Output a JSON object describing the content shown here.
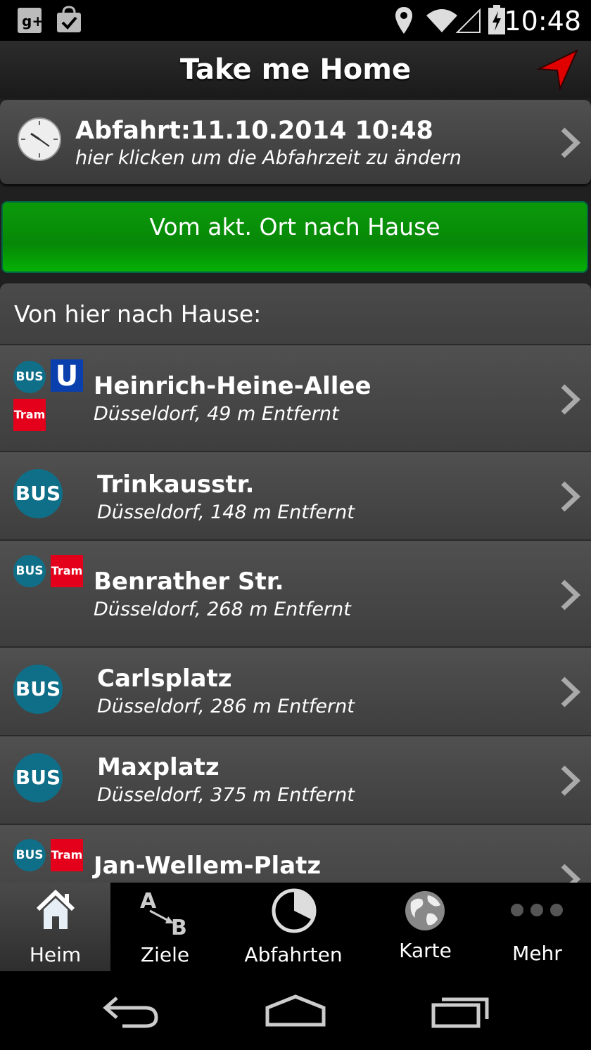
{
  "status_bar": {
    "time": "10:48"
  },
  "app_bar": {
    "title": "Take me Home"
  },
  "departure": {
    "title": "Abfahrt:11.10.2014 10:48",
    "subtitle": "hier klicken um die Abfahrzeit zu ändern"
  },
  "home_button": {
    "label": "Vom akt. Ort nach Hause"
  },
  "list": {
    "header": "Von hier nach Hause:",
    "badges": {
      "bus": "BUS",
      "tram": "Tram",
      "ubahn": "U"
    },
    "stops": [
      {
        "name": "Heinrich-Heine-Allee",
        "detail": "Düsseldorf, 49 m Entfernt"
      },
      {
        "name": "Trinkausstr.",
        "detail": "Düsseldorf, 148 m Entfernt"
      },
      {
        "name": "Benrather Str.",
        "detail": "Düsseldorf, 268 m Entfernt"
      },
      {
        "name": "Carlsplatz",
        "detail": "Düsseldorf, 286 m Entfernt"
      },
      {
        "name": "Maxplatz",
        "detail": "Düsseldorf, 375 m Entfernt"
      },
      {
        "name": "Jan-Wellem-Platz",
        "detail": ""
      }
    ]
  },
  "tabs": [
    {
      "label": "Heim",
      "icon": "home-icon"
    },
    {
      "label": "Ziele",
      "icon": "a-to-b-icon"
    },
    {
      "label": "Abfahrten",
      "icon": "pie-clock-icon"
    },
    {
      "label": "Karte",
      "icon": "globe-icon"
    },
    {
      "label": "Mehr",
      "icon": "more-dots-icon"
    }
  ],
  "ab_icon_letters": {
    "a": "A",
    "b": "B"
  },
  "colors": {
    "accent_green": "#078807",
    "bus_teal": "#0f6f88",
    "tram_red": "#e4001b",
    "ubahn_blue": "#0a3fae",
    "nav_arrow": "#e00000"
  }
}
